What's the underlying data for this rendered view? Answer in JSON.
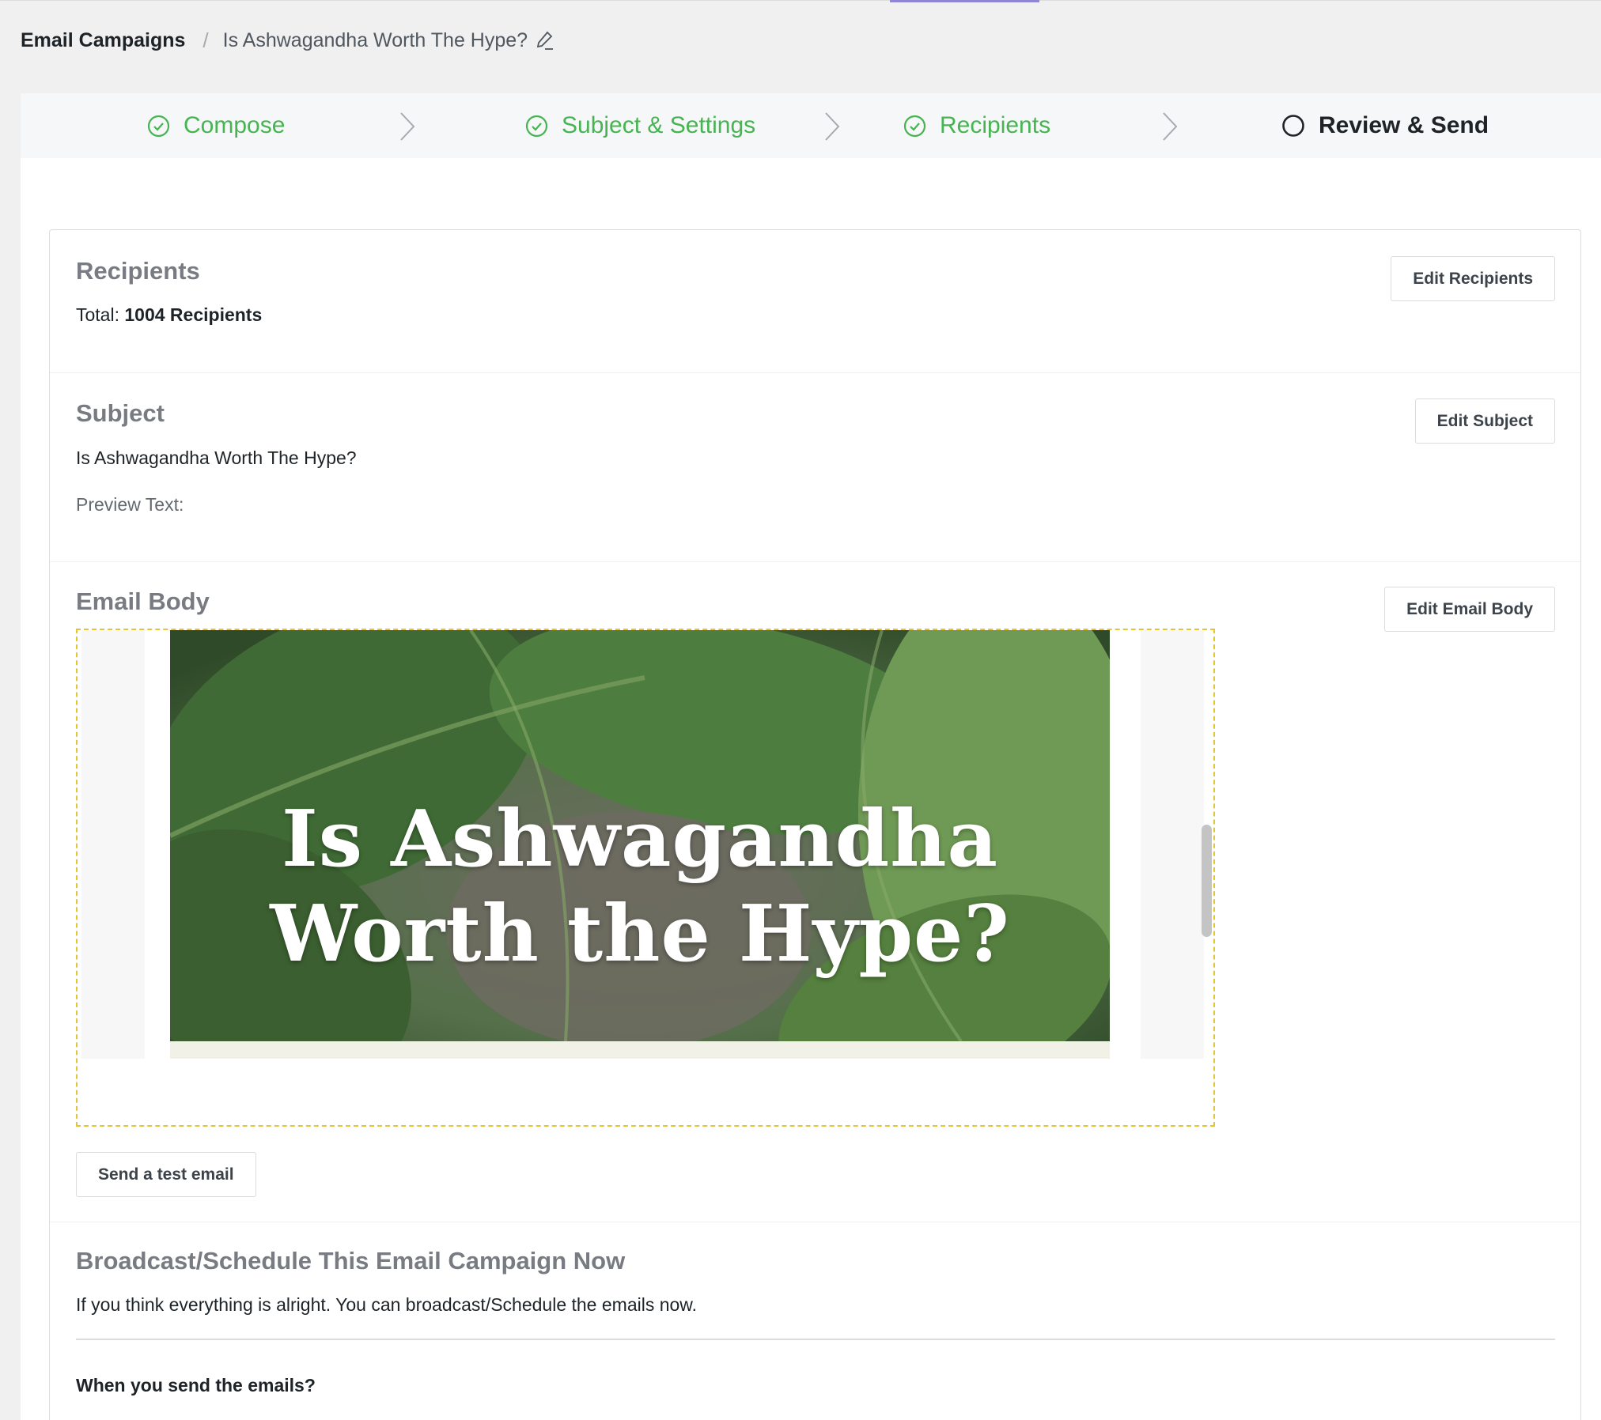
{
  "breadcrumb": {
    "root": "Email Campaigns",
    "separator": "/",
    "current": "Is Ashwagandha Worth The Hype?"
  },
  "steps": [
    {
      "label": "Compose",
      "state": "done"
    },
    {
      "label": "Subject & Settings",
      "state": "done"
    },
    {
      "label": "Recipients",
      "state": "done"
    },
    {
      "label": "Review & Send",
      "state": "active"
    }
  ],
  "recipients": {
    "title": "Recipients",
    "total_prefix": "Total:",
    "total_value": "1004 Recipients",
    "edit_button": "Edit Recipients"
  },
  "subject": {
    "title": "Subject",
    "value": "Is Ashwagandha Worth The Hype?",
    "preview_text_label": "Preview Text:",
    "edit_button": "Edit Subject"
  },
  "email_body": {
    "title": "Email Body",
    "edit_button": "Edit Email Body",
    "hero_line1": "Is Ashwagandha",
    "hero_line2": "Worth the Hype?",
    "test_button": "Send a test email"
  },
  "broadcast": {
    "title": "Broadcast/Schedule This Email Campaign Now",
    "description": "If you think everything is alright. You can broadcast/Schedule the emails now.",
    "question": "When you send the emails?"
  },
  "colors": {
    "done_green": "#46b450",
    "preview_border": "#e3c53a",
    "accent_purple": "#8f86d6"
  }
}
